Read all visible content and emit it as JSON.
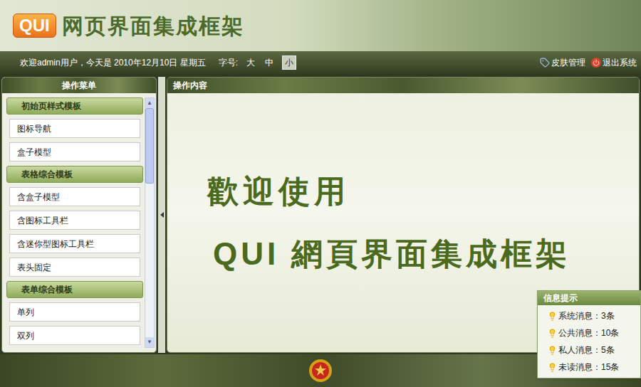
{
  "header": {
    "logo": "QUI",
    "title": "网页界面集成框架"
  },
  "topbar": {
    "welcome": "欢迎admin用户，今天是 2010年12月10日 星期五",
    "font_label": "字号:",
    "font_sizes": [
      {
        "label": "大",
        "selected": false
      },
      {
        "label": "中",
        "selected": false
      },
      {
        "label": "小",
        "selected": true
      }
    ],
    "links": [
      "皮肤管理",
      "退出系统"
    ]
  },
  "sidebar": {
    "title": "操作菜单",
    "groups": [
      {
        "title": "初始页样式模板",
        "items": [
          "图标导航",
          "盒子模型"
        ]
      },
      {
        "title": "表格综合模板",
        "items": [
          "含盒子模型",
          "含图标工具栏",
          "含迷你型图标工具栏",
          "表头固定"
        ]
      },
      {
        "title": "表单综合模板",
        "items": [
          "单列",
          "双列"
        ]
      }
    ],
    "scrollbar": {
      "position": 0,
      "thumb_share": 0.33
    }
  },
  "content": {
    "title": "操作内容",
    "welcome_lines": [
      "歡迎使用",
      "QUI 網頁界面集成框架"
    ]
  },
  "popup": {
    "title": "信息提示",
    "items": [
      "系统消息：3条",
      "公共消息：10条",
      "私人消息：5条",
      "未读消息：15条"
    ]
  }
}
